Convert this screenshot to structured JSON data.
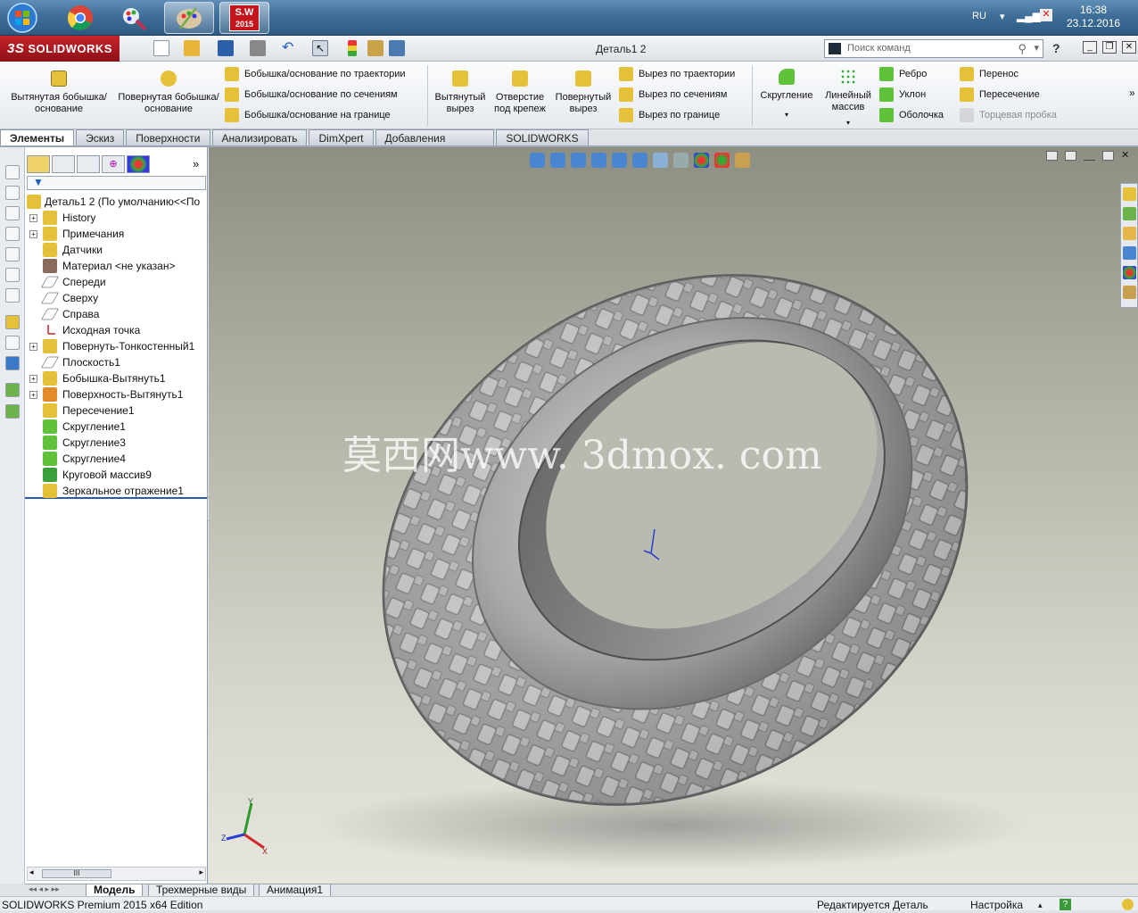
{
  "taskbar": {
    "language": "RU",
    "time": "16:38",
    "date": "23.12.2016",
    "apps": [
      "windows-start",
      "chrome",
      "paint",
      "palette",
      "solidworks-2015"
    ],
    "sw_badge": "S.W",
    "sw_year": "2015"
  },
  "titlebar": {
    "logo": "SOLIDWORKS",
    "document": "Деталь1 2",
    "search_placeholder": "Поиск команд",
    "help": "?"
  },
  "ribbon": {
    "extrude_boss": "Вытянутая бобышка/основание",
    "revolve_boss": "Повернутая бобышка/основание",
    "swept_boss": "Бобышка/основание по траектории",
    "lofted_boss": "Бобышка/основание по сечениям",
    "boundary_boss": "Бобышка/основание на границе",
    "extrude_cut": "Вытянутый вырез",
    "hole_wizard": "Отверстие под крепеж",
    "revolve_cut": "Повернутый вырез",
    "swept_cut": "Вырез по траектории",
    "lofted_cut": "Вырез по сечениям",
    "boundary_cut": "Вырез по границе",
    "fillet": "Скругление",
    "linear_pattern": "Линейный массив",
    "rib": "Ребро",
    "draft": "Уклон",
    "shell": "Оболочка",
    "wrap": "Перенос",
    "intersect": "Пересечение",
    "end_cap": "Торцевая пробка"
  },
  "command_tabs": [
    "Элементы",
    "Эскиз",
    "Поверхности",
    "Анализировать",
    "DimXpert",
    "Добавления SOLIDWORKS",
    "SOLIDWORKS MBD"
  ],
  "tree": {
    "root": "Деталь1 2  (По умолчанию<<По",
    "items": [
      {
        "label": "History",
        "icon": "history-icon",
        "expandable": true
      },
      {
        "label": "Примечания",
        "icon": "annotations-icon",
        "expandable": true
      },
      {
        "label": "Датчики",
        "icon": "sensors-icon",
        "expandable": false
      },
      {
        "label": "Материал <не указан>",
        "icon": "material-icon",
        "expandable": false
      },
      {
        "label": "Спереди",
        "icon": "plane-icon",
        "expandable": false
      },
      {
        "label": "Сверху",
        "icon": "plane-icon",
        "expandable": false
      },
      {
        "label": "Справа",
        "icon": "plane-icon",
        "expandable": false
      },
      {
        "label": "Исходная точка",
        "icon": "origin-icon",
        "expandable": false
      },
      {
        "label": "Повернуть-Тонкостенный1",
        "icon": "revolve-thin-icon",
        "expandable": true
      },
      {
        "label": "Плоскость1",
        "icon": "plane-icon",
        "expandable": false
      },
      {
        "label": "Бобышка-Вытянуть1",
        "icon": "extrude-icon",
        "expandable": true
      },
      {
        "label": "Поверхность-Вытянуть1",
        "icon": "surface-extrude-icon",
        "expandable": true
      },
      {
        "label": "Пересечение1",
        "icon": "intersect-icon",
        "expandable": false
      },
      {
        "label": "Скругление1",
        "icon": "fillet-icon",
        "expandable": false
      },
      {
        "label": "Скругление3",
        "icon": "fillet-icon",
        "expandable": false
      },
      {
        "label": "Скругление4",
        "icon": "fillet-icon",
        "expandable": false
      },
      {
        "label": "Круговой массив9",
        "icon": "circular-pattern-icon",
        "expandable": false
      },
      {
        "label": "Зеркальное отражение1",
        "icon": "mirror-icon",
        "expandable": false
      }
    ]
  },
  "viewport": {
    "watermark": "莫西网www. 3dmox. com",
    "axis_labels": [
      "Y",
      "Z",
      "X"
    ]
  },
  "bottom_tabs": [
    "Модель",
    "Трехмерные виды",
    "Анимация1"
  ],
  "status": {
    "product": "SOLIDWORKS Premium 2015 x64 Edition",
    "editing": "Редактируется Деталь",
    "settings": "Настройка"
  },
  "colors": {
    "sw_red": "#b01c24",
    "tree_selection": "#2a5bb0"
  }
}
